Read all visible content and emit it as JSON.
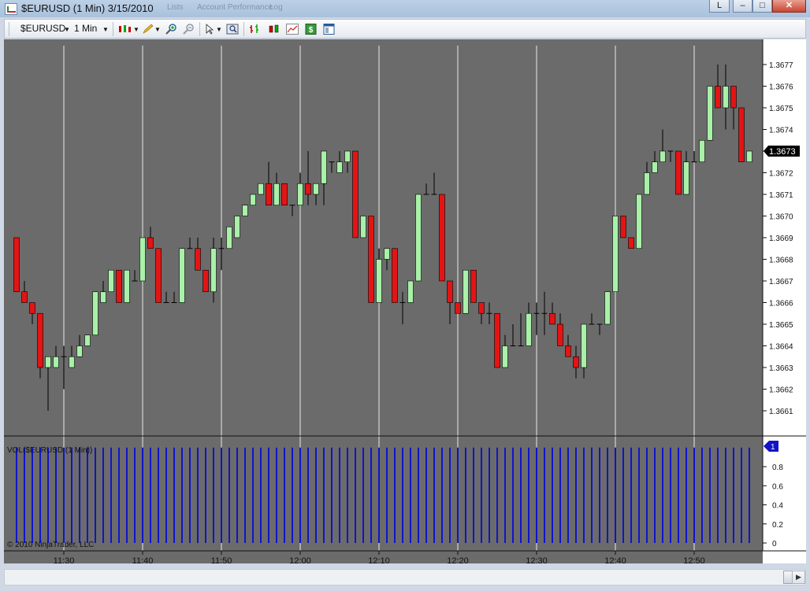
{
  "window": {
    "title": "$EURUSD (1 Min)  3/15/2010",
    "ghost_tabs": [
      "Lists",
      "Account Performance",
      "Log"
    ],
    "btn_l": "L",
    "btn_min": "–",
    "btn_max": "□",
    "btn_close": "✕"
  },
  "toolbar": {
    "instrument": "$EURUSD",
    "interval": "1 Min",
    "icons": [
      "candlestick-style-icon",
      "pencil-draw-icon",
      "zoom-in-icon",
      "zoom-out-icon",
      "cursor-pointer-icon",
      "magnify-icon",
      "bar-chart-icon",
      "candles-icon",
      "line-chart-icon",
      "dollar-icon",
      "properties-icon"
    ]
  },
  "colors": {
    "background": "#6b6b6b",
    "up": "#a9f0a9",
    "down": "#e41414",
    "wick": "#000000",
    "volume": "#1313c8",
    "gridline": "#e8e8e8",
    "price_marker_bg": "#000000"
  },
  "price_panel": {
    "current_price": "1.3673"
  },
  "volume_panel": {
    "label": "VOL($EURUSD (1 Min))",
    "copyright": "© 2010 NinjaTrader, LLC",
    "current_value": "1"
  },
  "chart_data": {
    "type": "candlestick",
    "x_tick_labels": [
      "11:30",
      "11:40",
      "11:50",
      "12:00",
      "12:10",
      "12:20",
      "12:30",
      "12:40",
      "12:50"
    ],
    "price_axis": {
      "ticks": [
        "1.3661",
        "1.3662",
        "1.3663",
        "1.3664",
        "1.3665",
        "1.3666",
        "1.3667",
        "1.3668",
        "1.3669",
        "1.3670",
        "1.3671",
        "1.3672",
        "1.3673",
        "1.3674",
        "1.3675",
        "1.3676",
        "1.3677"
      ],
      "range": [
        1.36597,
        1.36782
      ]
    },
    "volume_axis": {
      "ticks": [
        "0",
        "0.2",
        "0.4",
        "0.6",
        "0.8"
      ],
      "range": [
        0,
        1
      ]
    },
    "candles_ohlc": [
      [
        1.3669,
        1.3669,
        1.36665,
        1.36665
      ],
      [
        1.36665,
        1.3667,
        1.3666,
        1.3666
      ],
      [
        1.3666,
        1.3666,
        1.3665,
        1.36655
      ],
      [
        1.36655,
        1.36655,
        1.36625,
        1.3663
      ],
      [
        1.3663,
        1.36635,
        1.3661,
        1.36635
      ],
      [
        1.3663,
        1.3664,
        1.3663,
        1.36635
      ],
      [
        1.36635,
        1.3664,
        1.3662,
        1.36635
      ],
      [
        1.3663,
        1.3664,
        1.3663,
        1.36635
      ],
      [
        1.36635,
        1.36645,
        1.36635,
        1.3664
      ],
      [
        1.3664,
        1.36645,
        1.3664,
        1.36645
      ],
      [
        1.36645,
        1.36665,
        1.36645,
        1.36665
      ],
      [
        1.3666,
        1.3667,
        1.3666,
        1.36665
      ],
      [
        1.36665,
        1.3667,
        1.36665,
        1.36675
      ],
      [
        1.36675,
        1.36675,
        1.3666,
        1.3666
      ],
      [
        1.3666,
        1.36665,
        1.3666,
        1.36675
      ],
      [
        1.3667,
        1.36675,
        1.3667,
        1.3667
      ],
      [
        1.3667,
        1.3669,
        1.3667,
        1.3669
      ],
      [
        1.3669,
        1.36695,
        1.36685,
        1.36685
      ],
      [
        1.36685,
        1.36685,
        1.3666,
        1.3666
      ],
      [
        1.3666,
        1.36665,
        1.3666,
        1.3666
      ],
      [
        1.3666,
        1.36665,
        1.3666,
        1.3666
      ],
      [
        1.3666,
        1.36685,
        1.3666,
        1.36685
      ],
      [
        1.36685,
        1.3669,
        1.36685,
        1.36685
      ],
      [
        1.36685,
        1.3669,
        1.36675,
        1.36675
      ],
      [
        1.36675,
        1.36675,
        1.36665,
        1.36665
      ],
      [
        1.36665,
        1.3669,
        1.3666,
        1.36685
      ],
      [
        1.36685,
        1.3669,
        1.36675,
        1.36685
      ],
      [
        1.36685,
        1.36695,
        1.36685,
        1.36695
      ],
      [
        1.3669,
        1.367,
        1.3669,
        1.367
      ],
      [
        1.367,
        1.36705,
        1.367,
        1.36705
      ],
      [
        1.36705,
        1.3671,
        1.36705,
        1.3671
      ],
      [
        1.3671,
        1.36715,
        1.3671,
        1.36715
      ],
      [
        1.36715,
        1.36725,
        1.36705,
        1.36705
      ],
      [
        1.36705,
        1.3672,
        1.36705,
        1.36715
      ],
      [
        1.36715,
        1.36715,
        1.36705,
        1.36705
      ],
      [
        1.36705,
        1.36705,
        1.367,
        1.36705
      ],
      [
        1.36705,
        1.3672,
        1.36705,
        1.36715
      ],
      [
        1.36715,
        1.3673,
        1.36705,
        1.3671
      ],
      [
        1.3671,
        1.36715,
        1.36705,
        1.36715
      ],
      [
        1.36715,
        1.3673,
        1.36705,
        1.3673
      ],
      [
        1.36725,
        1.36725,
        1.3672,
        1.36725
      ],
      [
        1.3672,
        1.3673,
        1.3672,
        1.36725
      ],
      [
        1.36725,
        1.3673,
        1.3672,
        1.3673
      ],
      [
        1.3673,
        1.3673,
        1.3669,
        1.3669
      ],
      [
        1.3669,
        1.367,
        1.3669,
        1.367
      ],
      [
        1.367,
        1.367,
        1.3666,
        1.3666
      ],
      [
        1.3666,
        1.36685,
        1.3666,
        1.3668
      ],
      [
        1.3668,
        1.36685,
        1.36675,
        1.36685
      ],
      [
        1.36685,
        1.36685,
        1.3666,
        1.3666
      ],
      [
        1.3666,
        1.36665,
        1.3665,
        1.3666
      ],
      [
        1.3666,
        1.3667,
        1.3666,
        1.3667
      ],
      [
        1.3667,
        1.3671,
        1.3667,
        1.3671
      ],
      [
        1.3671,
        1.36715,
        1.3671,
        1.3671
      ],
      [
        1.3671,
        1.3672,
        1.3671,
        1.3671
      ],
      [
        1.3671,
        1.3671,
        1.3667,
        1.3667
      ],
      [
        1.3667,
        1.3667,
        1.3665,
        1.3666
      ],
      [
        1.3666,
        1.3666,
        1.36655,
        1.36655
      ],
      [
        1.36655,
        1.36675,
        1.36655,
        1.36675
      ],
      [
        1.36675,
        1.36675,
        1.3666,
        1.3666
      ],
      [
        1.3666,
        1.3666,
        1.3665,
        1.36655
      ],
      [
        1.36655,
        1.3666,
        1.3665,
        1.36655
      ],
      [
        1.36655,
        1.36655,
        1.3664,
        1.3663
      ],
      [
        1.3663,
        1.36645,
        1.3663,
        1.3664
      ],
      [
        1.3664,
        1.3665,
        1.3664,
        1.3664
      ],
      [
        1.3664,
        1.36655,
        1.3664,
        1.3664
      ],
      [
        1.3664,
        1.3666,
        1.3664,
        1.36655
      ],
      [
        1.36655,
        1.3666,
        1.36645,
        1.36655
      ],
      [
        1.36655,
        1.36665,
        1.36645,
        1.36655
      ],
      [
        1.36655,
        1.3666,
        1.3665,
        1.3665
      ],
      [
        1.3665,
        1.36655,
        1.3664,
        1.3664
      ],
      [
        1.3664,
        1.36645,
        1.36635,
        1.36635
      ],
      [
        1.36635,
        1.3664,
        1.36625,
        1.3663
      ],
      [
        1.3663,
        1.3665,
        1.36625,
        1.3665
      ],
      [
        1.3665,
        1.36655,
        1.3665,
        1.3665
      ],
      [
        1.3665,
        1.3665,
        1.36645,
        1.3665
      ],
      [
        1.3665,
        1.36665,
        1.3665,
        1.36665
      ],
      [
        1.36665,
        1.367,
        1.36665,
        1.367
      ],
      [
        1.367,
        1.367,
        1.3669,
        1.3669
      ],
      [
        1.3669,
        1.3669,
        1.36685,
        1.36685
      ],
      [
        1.36685,
        1.3671,
        1.36685,
        1.3671
      ],
      [
        1.3671,
        1.36725,
        1.3671,
        1.3672
      ],
      [
        1.3672,
        1.3673,
        1.3672,
        1.36725
      ],
      [
        1.36725,
        1.3674,
        1.36725,
        1.3673
      ],
      [
        1.3673,
        1.3673,
        1.36725,
        1.3673
      ],
      [
        1.3673,
        1.3673,
        1.3671,
        1.3671
      ],
      [
        1.3671,
        1.3673,
        1.3671,
        1.36725
      ],
      [
        1.36725,
        1.3673,
        1.36725,
        1.36725
      ],
      [
        1.36725,
        1.36735,
        1.36725,
        1.36735
      ],
      [
        1.36735,
        1.3676,
        1.36735,
        1.3676
      ],
      [
        1.3676,
        1.3677,
        1.3675,
        1.3675
      ],
      [
        1.3675,
        1.3677,
        1.3674,
        1.3676
      ],
      [
        1.3676,
        1.3676,
        1.3674,
        1.3675
      ],
      [
        1.3675,
        1.3675,
        1.36725,
        1.36725
      ],
      [
        1.36725,
        1.3673,
        1.36725,
        1.3673
      ]
    ],
    "volume_values": "every bar = 1"
  }
}
